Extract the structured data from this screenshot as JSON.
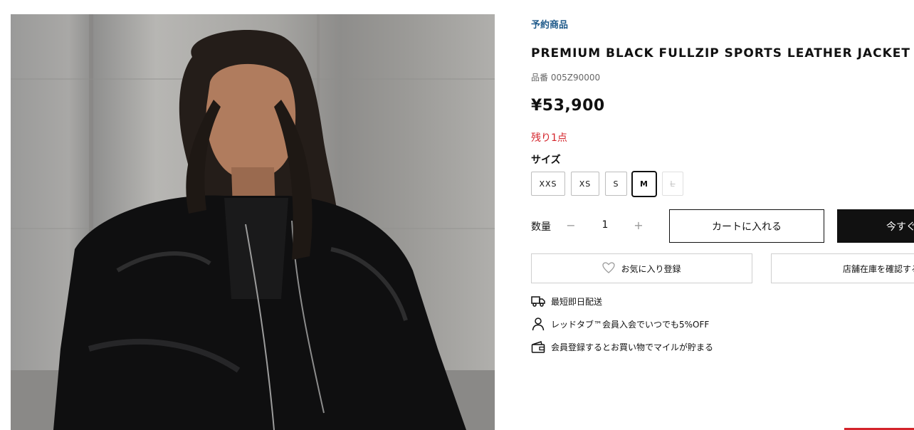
{
  "product": {
    "badge": "予約商品",
    "title": "PREMIUM BLACK FULLZIP SPORTS LEATHER JACKET",
    "sku": "品番 005Z90000",
    "price": "¥53,900",
    "stock": "残り1点"
  },
  "size": {
    "label": "サイズ",
    "options": [
      "XXS",
      "XS",
      "S",
      "M",
      "L"
    ],
    "selected": "M",
    "unavailable": [
      "L"
    ]
  },
  "quantity": {
    "label": "数量",
    "minus": "−",
    "value": "1",
    "plus": "+"
  },
  "actions": {
    "add_to_cart": "カートに入れる",
    "buy_now": "今すぐ",
    "favorite": "お気に入り登録",
    "store_stock": "店舗在庫を確認する"
  },
  "perks": [
    {
      "icon": "truck-icon",
      "text": "最短即日配送"
    },
    {
      "icon": "person-icon",
      "text": "レッドタブ™会員入会でいつでも5%OFF"
    },
    {
      "icon": "wallet-icon",
      "text": "会員登録するとお買い物でマイルが貯まる"
    }
  ],
  "colors": {
    "badge": "#1f5a8a",
    "stock": "#d4242b",
    "primary_button": "#111111",
    "accent": "#d4242b"
  }
}
